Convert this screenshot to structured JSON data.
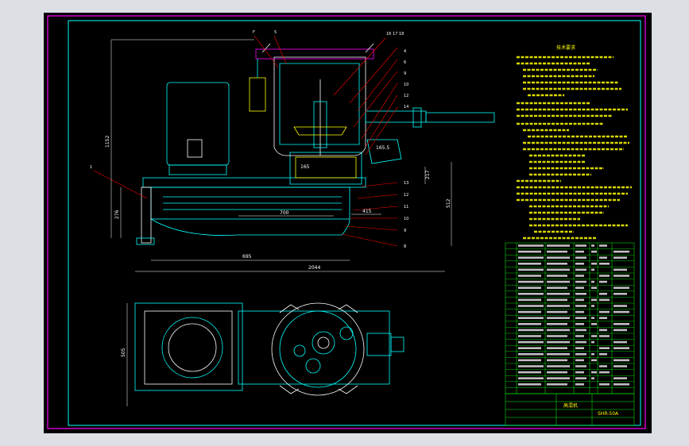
{
  "drawing": {
    "technical_requirements_title": "技术要求",
    "dimensions": {
      "overall_length": "2044",
      "base_length": "695",
      "sub_length": "700",
      "height_total": "1152",
      "height_base": "276",
      "right_height": "512",
      "d415": "415",
      "d165": "165",
      "d217": "217",
      "d165b": "165.5",
      "top_view_dim": "505"
    },
    "title_block": {
      "part_name": "高混机",
      "drawing_no": "SHR-50A"
    },
    "colors": {
      "background": "#000000",
      "frame": "#ff00ff",
      "lines": "#00ffff",
      "text": "#ffffff",
      "highlight": "#ffff00",
      "leaders": "#ff0000",
      "table": "#00ff00"
    }
  }
}
